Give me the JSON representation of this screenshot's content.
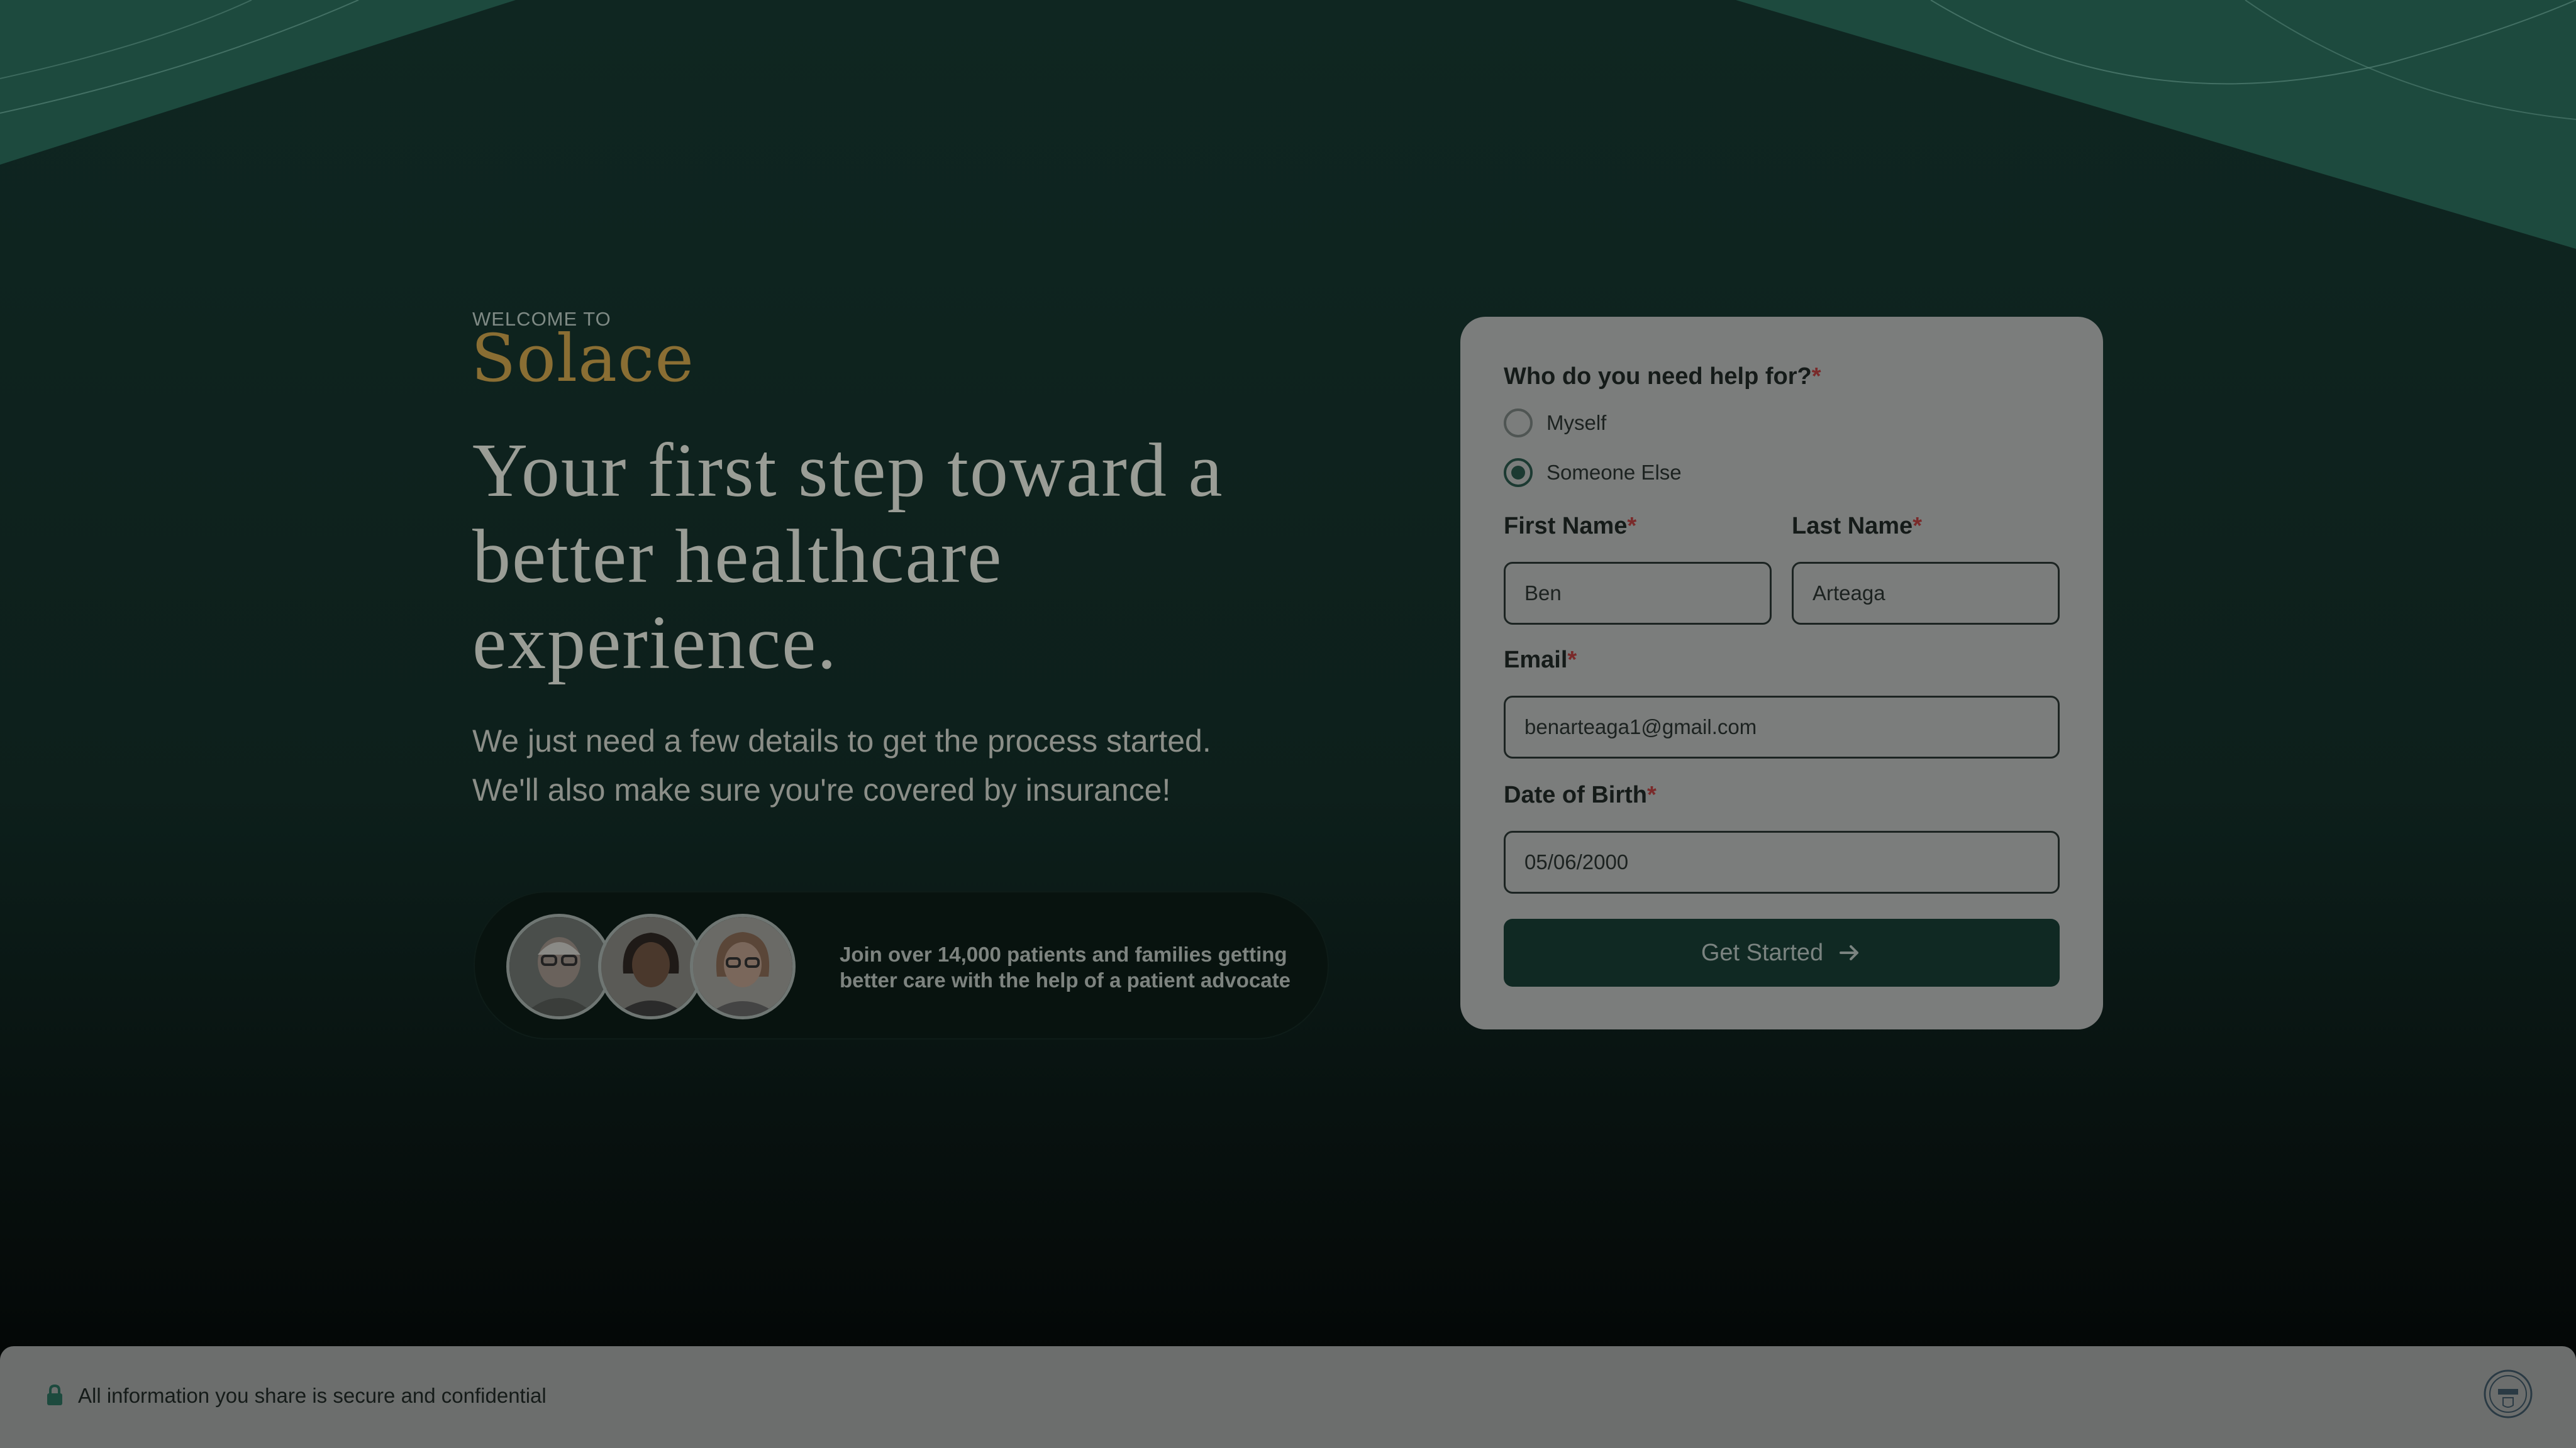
{
  "hero": {
    "welcome": "WELCOME TO",
    "brand": "Solace",
    "headline": "Your first step toward a better healthcare experience.",
    "subtext_line1": "We just need a few details to get the process started.",
    "subtext_line2": "We'll also make sure you're covered by insurance!",
    "social_proof": "Join over 14,000 patients and families getting better care with the help of a patient advocate"
  },
  "form": {
    "question": "Who do you need help for?",
    "required_mark": "*",
    "options": [
      {
        "label": "Myself",
        "selected": false
      },
      {
        "label": "Someone Else",
        "selected": true
      }
    ],
    "first_name_label": "First Name",
    "first_name_value": "Ben",
    "last_name_label": "Last Name",
    "last_name_value": "Arteaga",
    "email_label": "Email",
    "email_value": "benarteaga1@gmail.com",
    "dob_label": "Date of Birth",
    "dob_value": "05/06/2000",
    "submit_label": "Get Started",
    "submit_icon": "arrow-right-icon"
  },
  "footer": {
    "security_text": "All information you share is secure and confidential",
    "lock_icon": "lock-icon",
    "badge_icon": "hipaa-badge-icon"
  },
  "colors": {
    "background": "#0f2621",
    "accent_green": "#1d4a3e",
    "brand_gold": "#8a6e33",
    "required": "#7a2a2a",
    "button": "#102923"
  }
}
